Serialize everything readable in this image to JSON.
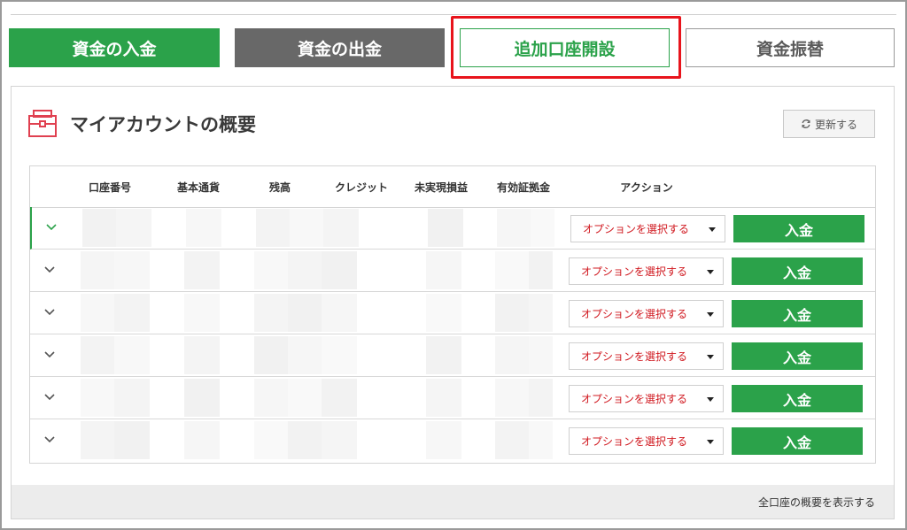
{
  "tabs": {
    "deposit": "資金の入金",
    "withdraw": "資金の出金",
    "add_account": "追加口座開設",
    "transfer": "資金振替"
  },
  "panel": {
    "title": "マイアカウントの概要",
    "refresh_label": "更新する",
    "footer_link": "全口座の概要を表示する"
  },
  "table": {
    "headers": {
      "account_number": "口座番号",
      "base_currency": "基本通貨",
      "balance": "残高",
      "credit": "クレジット",
      "unrealized_pnl": "未実現損益",
      "margin": "有効証拠金",
      "action": "アクション"
    },
    "rows": [
      {
        "select_label": "オプションを選択する",
        "deposit_label": "入金",
        "expanded": true
      },
      {
        "select_label": "オプションを選択する",
        "deposit_label": "入金",
        "expanded": false
      },
      {
        "select_label": "オプションを選択する",
        "deposit_label": "入金",
        "expanded": false
      },
      {
        "select_label": "オプションを選択する",
        "deposit_label": "入金",
        "expanded": false
      },
      {
        "select_label": "オプションを選択する",
        "deposit_label": "入金",
        "expanded": false
      },
      {
        "select_label": "オプションを選択する",
        "deposit_label": "入金",
        "expanded": false
      }
    ]
  },
  "colors": {
    "brand_green": "#2ba24a",
    "dark_gray": "#686868",
    "highlight_red": "#e8141c",
    "select_text_red": "#d0181f"
  },
  "icons": {
    "panel": "briefcase-icon",
    "refresh": "refresh-icon",
    "row_toggle": "chevron-down-icon",
    "select": "caret-down-icon"
  }
}
